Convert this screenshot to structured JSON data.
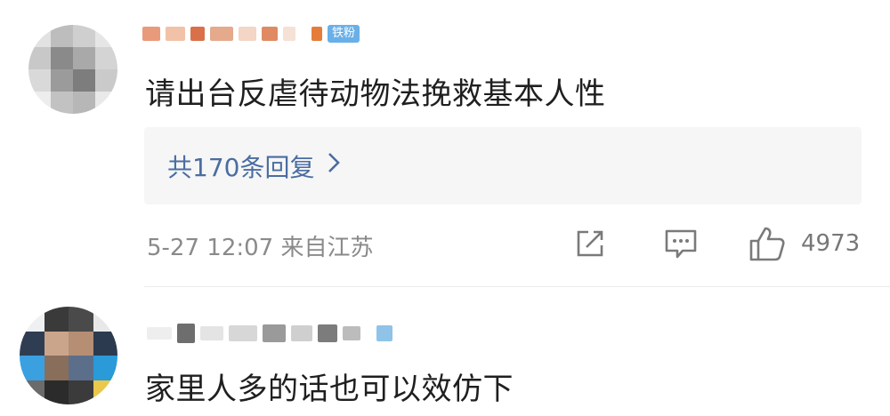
{
  "comments": [
    {
      "badge": "铁粉",
      "text": "请出台反虐待动物法挽救基本人性",
      "reply_link": "共170条回复",
      "meta": "5-27 12:07  来自江苏",
      "likes": "4973"
    },
    {
      "text": "家里人多的话也可以效仿下"
    }
  ],
  "icons": {
    "share": "share-icon",
    "comment": "comment-icon",
    "like": "thumbs-up-icon",
    "chevron": "chevron-right-icon"
  },
  "colors": {
    "link": "#4a6da1",
    "badge": "#69b0e8",
    "reply_bg": "#f6f6f6",
    "meta": "#8a8a8a"
  }
}
